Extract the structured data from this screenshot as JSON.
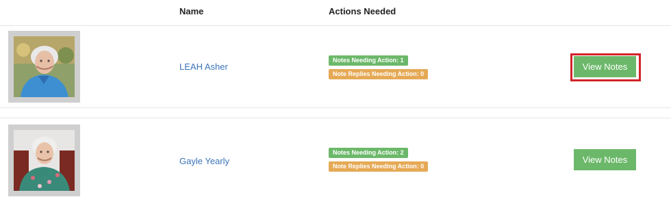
{
  "table": {
    "headers": {
      "name": "Name",
      "actions": "Actions Needed"
    },
    "rows": [
      {
        "name": "LEAH Asher",
        "photo": "portrait-elderly-woman-blue-jacket",
        "badges": {
          "notes": "Notes Needing Action: 1",
          "replies": "Note Replies Needing Action: 0"
        },
        "button": "View Notes",
        "button_highlighted": true
      },
      {
        "name": "Gayle Yearly",
        "photo": "portrait-elderly-woman-floral-dress",
        "badges": {
          "notes": "Notes Needing Action: 2",
          "replies": "Note Replies Needing Action: 0"
        },
        "button": "View Notes",
        "button_highlighted": false
      }
    ]
  },
  "colors": {
    "link": "#3a74b8",
    "badge_green": "#6cb86a",
    "badge_orange": "#e5a955",
    "button": "#6cb86a",
    "highlight": "#d2232a"
  }
}
